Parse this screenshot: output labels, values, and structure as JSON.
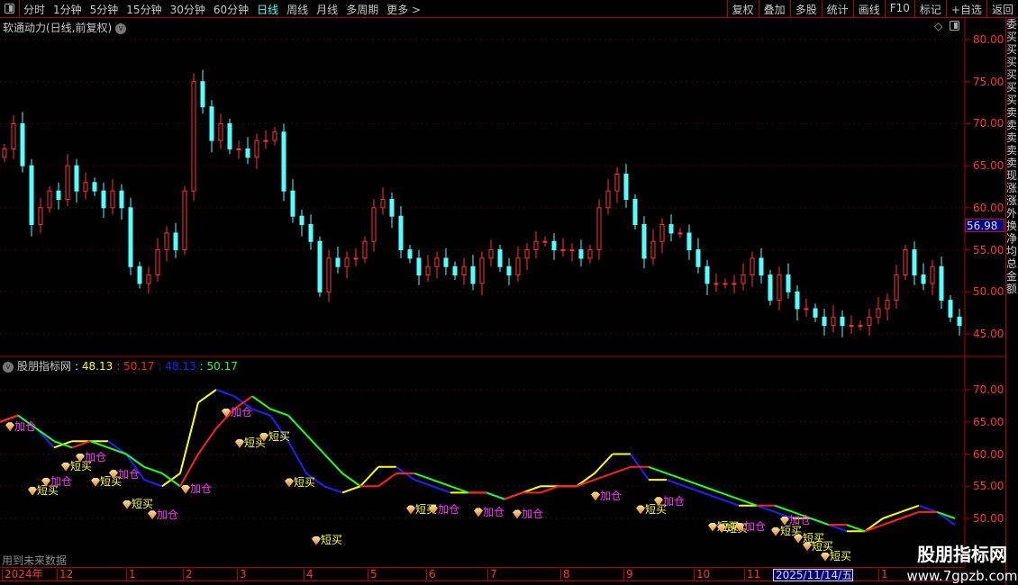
{
  "toolbar": {
    "periods": [
      "分时",
      "1分钟",
      "5分钟",
      "15分钟",
      "30分钟",
      "60分钟",
      "日线",
      "周线",
      "月线",
      "多周期",
      "更多 >"
    ],
    "active": "日线",
    "buttons": [
      "复权",
      "叠加",
      "多股",
      "统计",
      "画线",
      "F10",
      "标记",
      "+自选",
      "返回"
    ]
  },
  "main": {
    "title": "软通动力(日线,前复权)",
    "current_price": "56.98",
    "yticks": [
      "80.00",
      "75.00",
      "70.00",
      "65.00",
      "60.00",
      "55.00",
      "50.00",
      "45.00"
    ]
  },
  "indicator": {
    "name": "股朋指标网",
    "values": [
      {
        "text": "48.13",
        "color": "#ffff00"
      },
      {
        "text": "50.17",
        "color": "#ff2020"
      },
      {
        "text": "48.13",
        "color": "#2020ff"
      },
      {
        "text": "50.17",
        "color": "#20ff20"
      }
    ],
    "yticks": [
      "70.00",
      "65.00",
      "60.00",
      "55.00",
      "50.00"
    ],
    "note": "用到未来数据"
  },
  "date_axis": [
    "2024年",
    "12",
    "1",
    "2",
    "3",
    "4",
    "5",
    "6",
    "7",
    "8",
    "9",
    "10",
    "11",
    "2025/11/14/五",
    "1"
  ],
  "right_panel_text": "委买买买买买买卖卖卖卖卖现涨涨外换净均总金额",
  "watermark": {
    "name": "股朋指标网",
    "url": "www.7gpzb.com"
  },
  "chart_data": [
    {
      "type": "candlestick",
      "title": "软通动力(日线,前复权)",
      "ylim": [
        44,
        82
      ],
      "closes": [
        67,
        70,
        65,
        58,
        60,
        62,
        61,
        65,
        62,
        63,
        62,
        60,
        62,
        60,
        53,
        51,
        52,
        55,
        57,
        55,
        62,
        75,
        72,
        68,
        70,
        67,
        67,
        66,
        68,
        68,
        69,
        62,
        59,
        58,
        56,
        50,
        54,
        53,
        54,
        54,
        56,
        60,
        61,
        59,
        55,
        54,
        52,
        53,
        54,
        53,
        52,
        53,
        51,
        54,
        55,
        53,
        52,
        54,
        55,
        56,
        56,
        55,
        55,
        55,
        54,
        55,
        60,
        62,
        64,
        61,
        58,
        54,
        56,
        58,
        57,
        57,
        55,
        53,
        51,
        51,
        51,
        51,
        52,
        54,
        52,
        49,
        52,
        50,
        48,
        48,
        47,
        46,
        47,
        46,
        46,
        46,
        47,
        48,
        49,
        52,
        55,
        52,
        51,
        53,
        49,
        47,
        46
      ],
      "up_color": "#ff3232",
      "down_color": "#54ffff"
    },
    {
      "type": "line",
      "title": "股朋指标网",
      "ylim": [
        43,
        74
      ],
      "series": [
        {
          "name": "fast",
          "rise_color": "#ffff00",
          "fall_color": "#2020ff",
          "values": [
            65,
            66,
            64,
            61,
            62,
            62,
            62,
            60,
            56,
            55,
            57,
            68,
            70,
            69,
            67,
            66,
            62,
            57,
            55,
            54,
            55,
            58,
            58,
            56,
            55,
            54,
            54,
            54,
            53,
            54,
            55,
            55,
            55,
            57,
            60,
            60,
            56,
            56,
            55,
            54,
            53,
            52,
            52,
            51,
            50,
            50,
            49,
            48,
            48,
            50,
            51,
            52,
            51,
            49
          ]
        },
        {
          "name": "slow",
          "rise_color": "#ff2020",
          "fall_color": "#20ff20",
          "values": [
            65,
            66,
            64,
            62,
            61,
            62,
            61,
            60,
            58,
            57,
            55,
            60,
            64,
            67,
            69,
            67,
            66,
            63,
            60,
            57,
            55,
            55,
            57,
            57,
            56,
            55,
            54,
            54,
            53,
            54,
            54,
            55,
            55,
            56,
            57,
            58,
            58,
            57,
            56,
            55,
            54,
            53,
            52,
            52,
            51,
            50,
            49,
            49,
            48,
            49,
            50,
            51,
            51,
            50
          ]
        }
      ],
      "signals": [
        {
          "t": 1,
          "v": 64.3,
          "label": "加仓"
        },
        {
          "t": 3.5,
          "v": 54.3,
          "label": "短买"
        },
        {
          "t": 5,
          "v": 55.7,
          "label": "加仓"
        },
        {
          "t": 7.2,
          "v": 58.1,
          "label": "短买"
        },
        {
          "t": 8.8,
          "v": 59.5,
          "label": "加仓"
        },
        {
          "t": 10.5,
          "v": 55.7,
          "label": "短买"
        },
        {
          "t": 12.5,
          "v": 56.9,
          "label": "加仓"
        },
        {
          "t": 14,
          "v": 52.2,
          "label": "短买"
        },
        {
          "t": 16.8,
          "v": 50.6,
          "label": "加仓"
        },
        {
          "t": 20.5,
          "v": 54.6,
          "label": "加仓"
        },
        {
          "t": 25,
          "v": 66.5,
          "label": "加仓"
        },
        {
          "t": 26.5,
          "v": 61.7,
          "label": "短买"
        },
        {
          "t": 29.2,
          "v": 62.7,
          "label": "短买"
        },
        {
          "t": 32,
          "v": 55.6,
          "label": "短买"
        },
        {
          "t": 35,
          "v": 46.6,
          "label": "短买"
        },
        {
          "t": 45.5,
          "v": 51.4,
          "label": "短买"
        },
        {
          "t": 48,
          "v": 51.4,
          "label": "加仓"
        },
        {
          "t": 53,
          "v": 51.0,
          "label": "加仓"
        },
        {
          "t": 57.3,
          "v": 50.7,
          "label": "加仓"
        },
        {
          "t": 66,
          "v": 53.5,
          "label": "加仓"
        },
        {
          "t": 71,
          "v": 51.4,
          "label": "短买"
        },
        {
          "t": 73,
          "v": 52.7,
          "label": "加仓"
        },
        {
          "t": 79,
          "v": 48.7,
          "label": "短买"
        },
        {
          "t": 80,
          "v": 48.5,
          "label": "短买"
        },
        {
          "t": 82,
          "v": 48.7,
          "label": "加仓"
        },
        {
          "t": 86,
          "v": 48.0,
          "label": "短买"
        },
        {
          "t": 87,
          "v": 49.7,
          "label": "加仓"
        },
        {
          "t": 88.5,
          "v": 46.9,
          "label": "短买"
        },
        {
          "t": 89.5,
          "v": 45.7,
          "label": "短买"
        },
        {
          "t": 91.5,
          "v": 44.1,
          "label": "短买"
        }
      ]
    }
  ]
}
